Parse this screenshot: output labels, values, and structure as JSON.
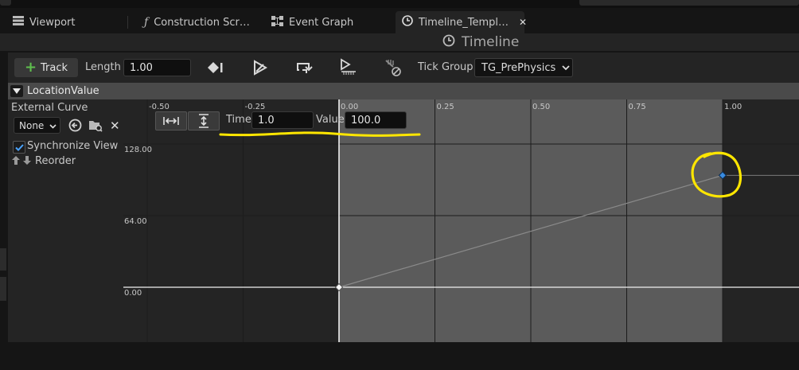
{
  "tabs": [
    {
      "label": "Viewport",
      "icon": "grid-icon",
      "active": false
    },
    {
      "label": "Construction Scr…",
      "icon": "function-icon",
      "active": false
    },
    {
      "label": "Event Graph",
      "icon": "graph-icon",
      "active": false
    },
    {
      "label": "Timeline_Templ…",
      "icon": "clock-icon",
      "active": true
    }
  ],
  "window": {
    "title": "Timeline"
  },
  "toolbar": {
    "track_label": "Track",
    "length_label": "Length",
    "length_value": "1.00",
    "tick_group_label": "Tick Group",
    "tick_group_value": "TG_PrePhysics"
  },
  "track": {
    "name": "LocationValue",
    "external_curve_label": "External Curve",
    "curve_value": "None",
    "sync_view_label": "Synchronize View",
    "sync_view_checked": true,
    "reorder_label": "Reorder"
  },
  "key_editor": {
    "time_label": "Time",
    "time_value": "1.0",
    "value_label": "Value",
    "value_value": "100.0"
  },
  "graph": {
    "x_ticks": [
      "-0.50",
      "-0.25",
      "0.00",
      "0.25",
      "0.50",
      "0.75",
      "1.00"
    ],
    "y_ticks": [
      "128.00",
      "64.00",
      "0.00"
    ]
  },
  "chart_data": {
    "type": "line",
    "xlabel": "",
    "ylabel": "",
    "x_ticks": [
      -0.5,
      -0.25,
      0.0,
      0.25,
      0.5,
      0.75,
      1.0
    ],
    "y_ticks": [
      0,
      64,
      128
    ],
    "series": [
      {
        "values": [
          [
            0.0,
            0.0
          ],
          [
            1.0,
            100.0
          ]
        ]
      }
    ],
    "selected_key": {
      "time": 1.0,
      "value": 100.0
    },
    "colors": {
      "background": "#242424",
      "active_range": "#5b5b5b",
      "curve": "#8a8a8a",
      "selected_key": "#3a8ce0",
      "annotation": "#ffe600"
    }
  }
}
